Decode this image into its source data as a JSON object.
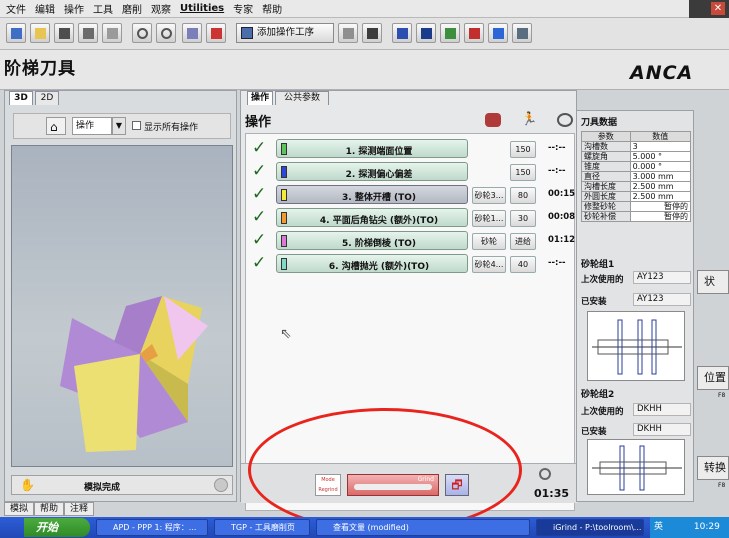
{
  "menu": {
    "items": [
      "文件",
      "编辑",
      "操作",
      "工具",
      "磨削",
      "观察",
      "Utilities",
      "专家",
      "帮助"
    ]
  },
  "toolbar": {
    "add_operation_label": "添加操作工序"
  },
  "page": {
    "title": "阶梯刀具",
    "logo": "ANCA"
  },
  "left_panel": {
    "tabs": [
      "3D",
      "2D"
    ],
    "op_select": "操作",
    "show_all_label": "显示所有操作",
    "sim_status": "模拟完成",
    "bottom_tabs": [
      "模拟",
      "帮助",
      "注释"
    ]
  },
  "main_panel": {
    "tabs": [
      "操作",
      "公共参数"
    ],
    "heading": "操作",
    "operations": [
      {
        "name": "1. 探测端面位置",
        "color": "#5ec35a",
        "wheel": "",
        "value": "150",
        "time": "--:--",
        "selected": false
      },
      {
        "name": "2. 探测偏心偏差",
        "color": "#2f47d8",
        "wheel": "",
        "value": "150",
        "time": "--:--",
        "selected": false
      },
      {
        "name": "3. 整体开槽 (TO)",
        "color": "#f5e93a",
        "wheel": "砂轮3...",
        "value": "80",
        "time": "00:15",
        "selected": true
      },
      {
        "name": "4. 平面后角钻尖 (额外)(TO)",
        "color": "#f39a2e",
        "wheel": "砂轮1...",
        "value": "30",
        "time": "00:08",
        "selected": false
      },
      {
        "name": "5. 阶梯倒棱 (TO)",
        "color": "#d77bd6",
        "wheel": "砂轮",
        "value": "进给",
        "time": "01:12",
        "selected": false
      },
      {
        "name": "6. 沟槽抛光 (额外)(TO)",
        "color": "#7fd9c9",
        "wheel": "砂轮4...",
        "value": "40",
        "time": "--:--",
        "selected": false
      }
    ],
    "mode_regrind_label": "Mode Regrind",
    "grind_label": "Grind",
    "total_time": "01:35"
  },
  "tool_data": {
    "heading": "刀具数据",
    "col_param": "参数",
    "col_value": "数值",
    "rows": [
      [
        "沟槽数",
        "3"
      ],
      [
        "螺旋角",
        "5.000 °"
      ],
      [
        "锥度",
        "0.000 °"
      ],
      [
        "直径",
        "3.000 mm"
      ],
      [
        "沟槽长度",
        "2.500 mm"
      ],
      [
        "外圆长度",
        "2.500 mm"
      ],
      [
        "修整砂轮",
        "暂停的"
      ],
      [
        "砂轮补偿",
        "暂停的"
      ]
    ]
  },
  "wheel_pack_1": {
    "heading": "砂轮组1",
    "last_used_label": "上次使用的",
    "last_used": "AY123",
    "installed_label": "已安装",
    "installed": "AY123"
  },
  "wheel_pack_2": {
    "heading": "砂轮组2",
    "last_used_label": "上次使用的",
    "last_used": "DKHH",
    "installed_label": "已安装",
    "installed": "DKHH"
  },
  "edge_buttons": [
    "状",
    "位置",
    "转换"
  ],
  "edge_f_labels": [
    "F8",
    "F8"
  ],
  "taskbar": {
    "start": "开始",
    "tasks": [
      "APD - PPP 1: 程序：...",
      "TGP - 工具磨削页",
      "查看文量 (modified)",
      "iGrind - P:\\toolroom\\..."
    ],
    "lang": "英",
    "clock": "10:29"
  }
}
